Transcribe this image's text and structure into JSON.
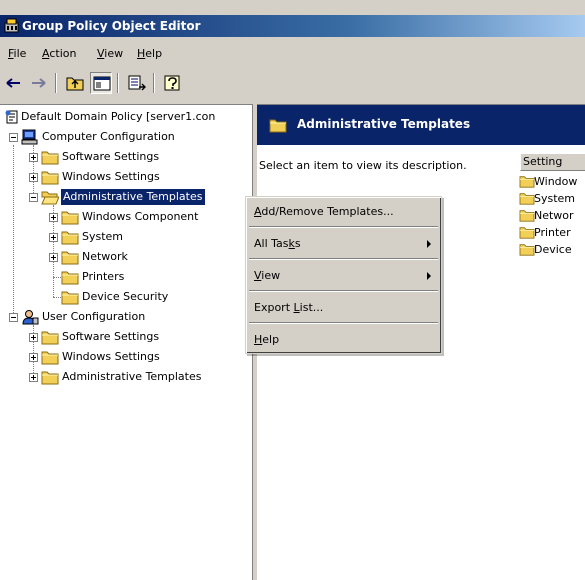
{
  "window": {
    "title": "Group Policy Object Editor"
  },
  "menu": {
    "file": {
      "u": "F",
      "rest": "ile"
    },
    "action": {
      "u": "A",
      "rest": "ction"
    },
    "view": {
      "u": "V",
      "rest": "iew"
    },
    "help": {
      "u": "H",
      "rest": "elp"
    }
  },
  "tree": {
    "root": "Default Domain Policy [server1.con",
    "computer_config": "Computer Configuration",
    "software_settings": "Software Settings",
    "windows_settings": "Windows Settings",
    "admin_templates": "Administrative Templates",
    "windows_components": "Windows Component",
    "system": "System",
    "network": "Network",
    "printers": "Printers",
    "device_security": "Device Security",
    "user_config": "User Configuration",
    "user_software_settings": "Software Settings",
    "user_windows_settings": "Windows Settings",
    "user_admin_templates": "Administrative Templates"
  },
  "right": {
    "header_title": "Administrative Templates",
    "description": "Select an item to view its description.",
    "column_setting": "Setting",
    "items": [
      "Window",
      "System",
      "Networ",
      "Printer",
      "Device"
    ]
  },
  "context_menu": {
    "add_remove": {
      "pre": "",
      "u": "A",
      "post": "dd/Remove Templates..."
    },
    "all_tasks": {
      "pre": "All Tas",
      "u": "k",
      "post": "s"
    },
    "view": {
      "pre": "",
      "u": "V",
      "post": "iew"
    },
    "export": {
      "pre": "Export ",
      "u": "L",
      "post": "ist..."
    },
    "help": {
      "pre": "",
      "u": "H",
      "post": "elp"
    }
  },
  "colors": {
    "title_bar": "#0a246a",
    "selection": "#0a246a",
    "chrome": "#d4d0c8",
    "folder": "#f2d057"
  }
}
